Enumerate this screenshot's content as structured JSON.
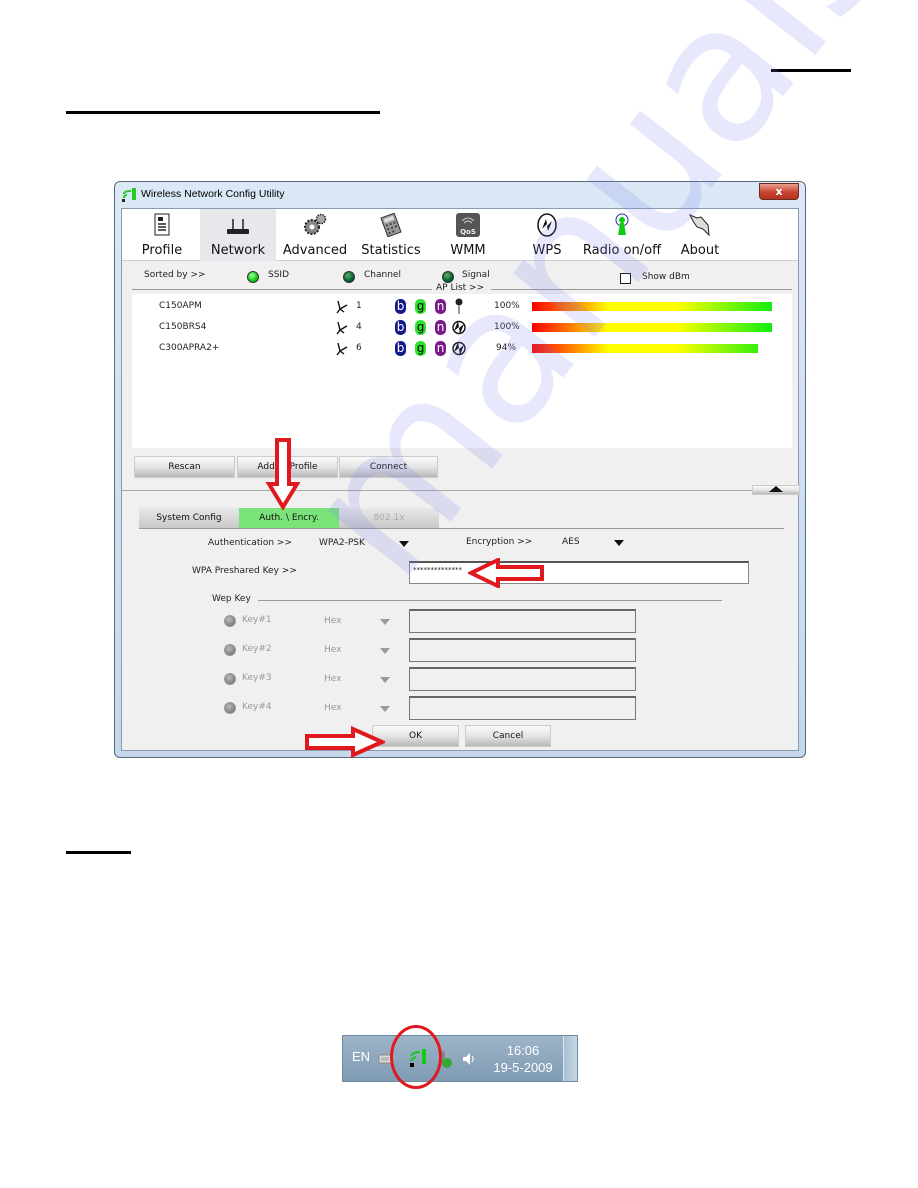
{
  "window": {
    "title": "Wireless Network Config Utility",
    "close_label": "x"
  },
  "toolbar": {
    "items": [
      {
        "label": "Profile",
        "icon": "profile-icon"
      },
      {
        "label": "Network",
        "icon": "router-icon",
        "active": true
      },
      {
        "label": "Advanced",
        "icon": "gears-icon"
      },
      {
        "label": "Statistics",
        "icon": "calculator-icon"
      },
      {
        "label": "WMM",
        "icon": "qos-icon"
      },
      {
        "label": "WPS",
        "icon": "wps-icon"
      },
      {
        "label": "Radio on/off",
        "icon": "antenna-icon"
      },
      {
        "label": "About",
        "icon": "about-icon"
      }
    ]
  },
  "sort": {
    "label": "Sorted by >>",
    "options": [
      {
        "label": "SSID",
        "selected": true
      },
      {
        "label": "Channel",
        "selected": false
      },
      {
        "label": "Signal",
        "selected": false
      }
    ],
    "show_dbm_label": "Show dBm",
    "show_dbm_checked": false,
    "ap_list_label": "AP List >>"
  },
  "ap_list": [
    {
      "ssid": "C150APM",
      "channel": "1",
      "modes": [
        "b",
        "g",
        "n"
      ],
      "security": "key",
      "signal": "100%",
      "signal_value": 100
    },
    {
      "ssid": "C150BRS4",
      "channel": "4",
      "modes": [
        "b",
        "g",
        "n"
      ],
      "security": "wps",
      "signal": "100%",
      "signal_value": 100
    },
    {
      "ssid": "C300APRA2+",
      "channel": "6",
      "modes": [
        "b",
        "g",
        "n"
      ],
      "security": "wps",
      "signal": "94%",
      "signal_value": 94
    }
  ],
  "actions": {
    "rescan": "Rescan",
    "add_to_profile": "Add to Profile",
    "connect": "Connect"
  },
  "tabs": [
    {
      "label": "System Config"
    },
    {
      "label": "Auth. \\ Encry.",
      "active": true
    },
    {
      "label": "802.1x",
      "disabled": true
    }
  ],
  "auth": {
    "authentication_label": "Authentication >>",
    "authentication_value": "WPA2-PSK",
    "encryption_label": "Encryption >>",
    "encryption_value": "AES",
    "psk_label": "WPA Preshared Key >>",
    "psk_value": "**************"
  },
  "wep": {
    "label": "Wep Key",
    "keys": [
      {
        "label": "Key#1",
        "format": "Hex",
        "value": ""
      },
      {
        "label": "Key#2",
        "format": "Hex",
        "value": ""
      },
      {
        "label": "Key#3",
        "format": "Hex",
        "value": ""
      },
      {
        "label": "Key#4",
        "format": "Hex",
        "value": ""
      }
    ]
  },
  "dialog": {
    "ok": "OK",
    "cancel": "Cancel"
  },
  "taskbar": {
    "language": "EN",
    "time": "16:06",
    "date": "19-5-2009"
  },
  "watermark": "manualslib"
}
